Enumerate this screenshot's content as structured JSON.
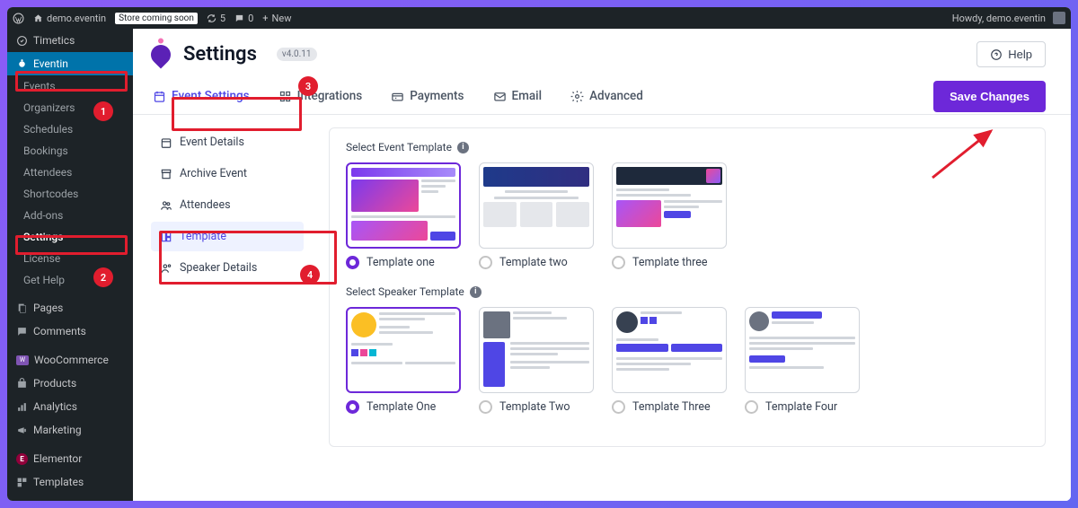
{
  "adminbar": {
    "site": "demo.eventin",
    "badge": "Store coming soon",
    "updates": "5",
    "comments": "0",
    "new": "New",
    "howdy": "Howdy, demo.eventin"
  },
  "sidebar": {
    "timetics": "Timetics",
    "eventin": "Eventin",
    "sub": [
      "Events",
      "Organizers",
      "Schedules",
      "Bookings",
      "Attendees",
      "Shortcodes",
      "Add-ons",
      "Settings",
      "License",
      "Get Help"
    ],
    "pages": "Pages",
    "comments": "Comments",
    "woocommerce": "WooCommerce",
    "products": "Products",
    "analytics": "Analytics",
    "marketing": "Marketing",
    "elementor": "Elementor",
    "templates": "Templates"
  },
  "page": {
    "title": "Settings",
    "version": "v4.0.11",
    "help": "Help",
    "save": "Save Changes"
  },
  "tabs": [
    "Event Settings",
    "Integrations",
    "Payments",
    "Email",
    "Advanced"
  ],
  "subnav": [
    "Event Details",
    "Archive Event",
    "Attendees",
    "Template",
    "Speaker Details"
  ],
  "sections": {
    "event_label": "Select Event Template",
    "speaker_label": "Select Speaker Template"
  },
  "event_templates": [
    "Template one",
    "Template two",
    "Template three"
  ],
  "speaker_templates": [
    "Template One",
    "Template Two",
    "Template Three",
    "Template Four"
  ],
  "annotations": {
    "n1": "1",
    "n2": "2",
    "n3": "3",
    "n4": "4"
  }
}
